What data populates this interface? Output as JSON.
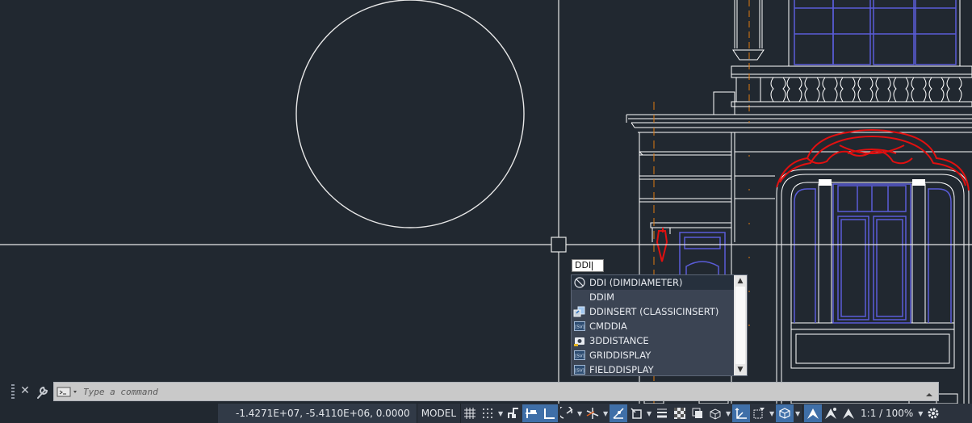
{
  "dynamic_input": {
    "value": "DDI"
  },
  "autocomplete": {
    "items": [
      {
        "label": "DDI (DIMDIAMETER)",
        "icon": "dimdiameter-icon",
        "selected": true
      },
      {
        "label": "DDIM",
        "icon": "",
        "selected": false
      },
      {
        "label": "DDINSERT (CLASSICINSERT)",
        "icon": "insert-block-icon",
        "selected": false
      },
      {
        "label": "CMDDIA",
        "icon": "system-variable-icon",
        "selected": false
      },
      {
        "label": "3DDISTANCE",
        "icon": "camera-distance-icon",
        "selected": false
      },
      {
        "label": "GRIDDISPLAY",
        "icon": "system-variable-icon",
        "selected": false
      },
      {
        "label": "FIELDDISPLAY",
        "icon": "system-variable-icon",
        "selected": false
      }
    ],
    "sysvar_badge": "[SV]"
  },
  "command_line": {
    "placeholder": "Type a command"
  },
  "status_bar": {
    "coordinates": "-1.4271E+07, -5.4110E+06, 0.0000",
    "space": "MODEL",
    "annotation_scale": "1:1 / 100%"
  },
  "colors": {
    "canvas": "#212830",
    "linework": "#ffffff",
    "blue_layer": "#5a5cd8",
    "red_layer": "#e01010",
    "orange_layer": "#e07a10",
    "toggle_on": "#3f6fa8"
  }
}
